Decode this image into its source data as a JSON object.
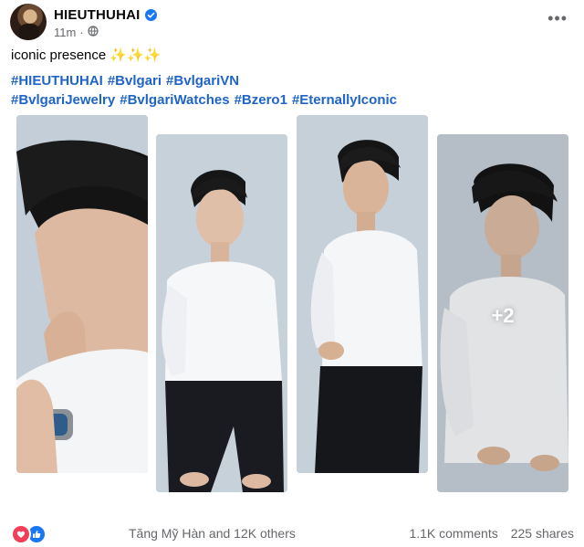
{
  "author": {
    "name": "HIEUTHUHAI",
    "verified": true
  },
  "meta": {
    "time": "11m",
    "separator": "·",
    "audience_icon": "globe-icon"
  },
  "caption": "iconic presence ✨✨✨",
  "hashtags": [
    "#HIEUTHUHAI",
    "#Bvlgari",
    "#BvlgariVN",
    "#BvlgariJewelry",
    "#BvlgariWatches",
    "#Bzero1",
    "#EternallyIconic"
  ],
  "photos": {
    "extra_count_label": "+2"
  },
  "footer": {
    "reactions": [
      "love-icon",
      "like-icon"
    ],
    "reacted_by": "Tăng Mỹ Hàn and 12K others",
    "comments": "1.1K comments",
    "shares": "225 shares"
  },
  "colors": {
    "link": "#1f64c8",
    "verified": "#1877f2",
    "love": "#f33e58",
    "secondary_text": "#65676b"
  }
}
